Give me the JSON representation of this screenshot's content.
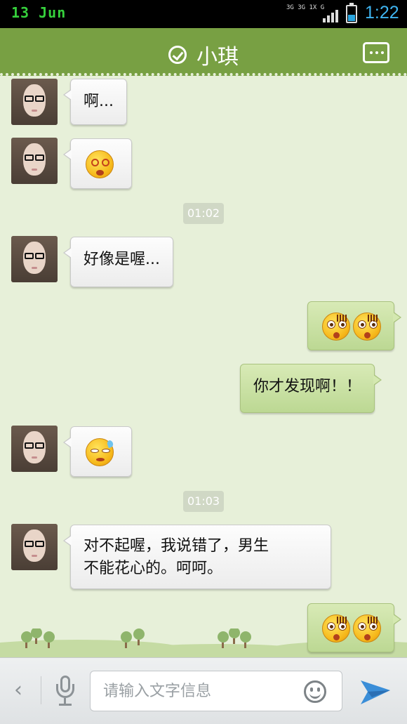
{
  "status_bar": {
    "date": "13 Jun",
    "network_label": "3G 3G 1X G",
    "time": "1:22",
    "battery_level": 0.4
  },
  "header": {
    "contact_name": "小琪",
    "verified_icon": "check-circle-icon",
    "menu_icon": "more-dots-icon"
  },
  "messages": [
    {
      "from": "contact",
      "type": "text",
      "text": "啊..."
    },
    {
      "from": "contact",
      "type": "emoji",
      "emoji": "dizzy-face-emoji"
    },
    {
      "type": "timestamp",
      "text": "01:02"
    },
    {
      "from": "contact",
      "type": "text",
      "text": "好像是喔..."
    },
    {
      "from": "me",
      "type": "emoji",
      "emoji": "shocked-face-emoji-x2"
    },
    {
      "from": "me",
      "type": "text",
      "text": "你才发现啊！！"
    },
    {
      "from": "contact",
      "type": "emoji",
      "emoji": "sweat-face-emoji"
    },
    {
      "type": "timestamp",
      "text": "01:03"
    },
    {
      "from": "contact",
      "type": "text",
      "lines": [
        "对不起喔，我说错了，男生",
        "不能花心的。呵呵。"
      ]
    },
    {
      "from": "me",
      "type": "emoji",
      "emoji": "shocked-face-emoji-x2"
    }
  ],
  "input_bar": {
    "placeholder": "请输入文字信息",
    "value": "",
    "back_icon": "chevron-left-icon",
    "voice_icon": "microphone-icon",
    "emoji_icon": "smiley-icon",
    "send_icon": "send-arrow-icon"
  },
  "colors": {
    "header_bg": "#78a043",
    "chat_bg": "#e7f0d9",
    "incoming_bubble": "#f5f5f5",
    "outgoing_bubble": "#c8e0a0",
    "timestamp_bg": "#d0d8c5",
    "clock": "#3fb4f0",
    "date": "#36d13c"
  }
}
